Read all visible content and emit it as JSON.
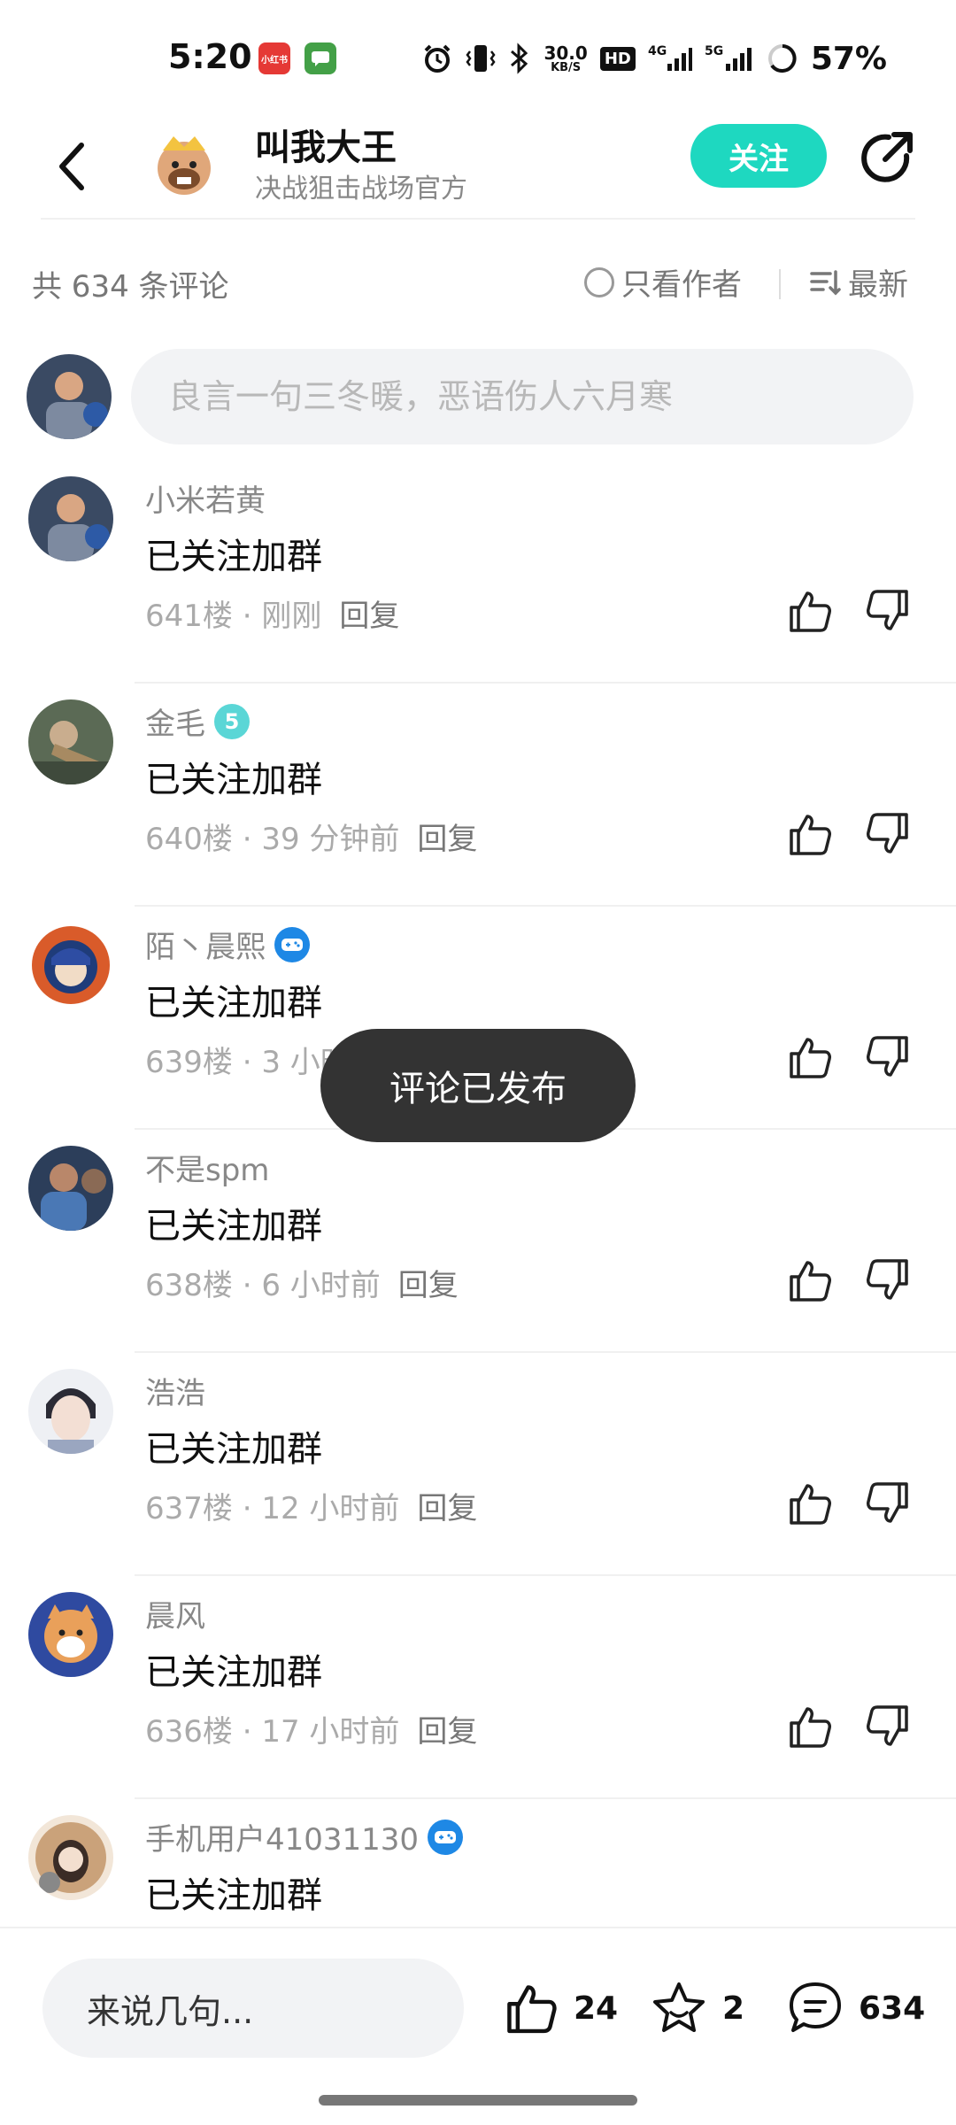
{
  "status_bar": {
    "time": "5:20",
    "net_speed_value": "30.0",
    "net_speed_unit": "KB/S",
    "hd_label": "HD",
    "signal_label_1": "4G",
    "signal_label_2": "5G",
    "battery": "57%",
    "app_badge_1_text": "小红书",
    "app_badge_1_color": "#e53935",
    "app_badge_2_color": "#43a047"
  },
  "header": {
    "author_name": "叫我大王",
    "author_sub": "决战狙击战场官方",
    "follow_label": "关注",
    "accent_color": "#1ed8c0"
  },
  "summary": {
    "count_label": "共 634 条评论",
    "author_only_label": "只看作者",
    "sort_label": "最新"
  },
  "composer": {
    "placeholder": "良言一句三冬暖，恶语伤人六月寒"
  },
  "comments": [
    {
      "name": "小米若黄",
      "text": "已关注加群",
      "floor": "641楼",
      "time": "刚刚",
      "reply": "回复",
      "badge": ""
    },
    {
      "name": "金毛",
      "text": "已关注加群",
      "floor": "640楼",
      "time": "39 分钟前",
      "reply": "回复",
      "badge": "5"
    },
    {
      "name": "陌丶晨熙",
      "text": "已关注加群",
      "floor": "639楼",
      "time": "3 小时前",
      "reply": "回复",
      "badge": "game"
    },
    {
      "name": "不是spm",
      "text": "已关注加群",
      "floor": "638楼",
      "time": "6 小时前",
      "reply": "回复",
      "badge": ""
    },
    {
      "name": "浩浩",
      "text": "已关注加群",
      "floor": "637楼",
      "time": "12 小时前",
      "reply": "回复",
      "badge": ""
    },
    {
      "name": "晨风",
      "text": "已关注加群",
      "floor": "636楼",
      "time": "17 小时前",
      "reply": "回复",
      "badge": ""
    },
    {
      "name": "手机用户41031130",
      "text": "已关注加群",
      "floor": "",
      "time": "",
      "reply": "",
      "badge": "game"
    }
  ],
  "toast": {
    "text": "评论已发布"
  },
  "bottom_bar": {
    "input_placeholder": "来说几句...",
    "like_count": "24",
    "favorite_count": "2",
    "comment_count": "634"
  }
}
